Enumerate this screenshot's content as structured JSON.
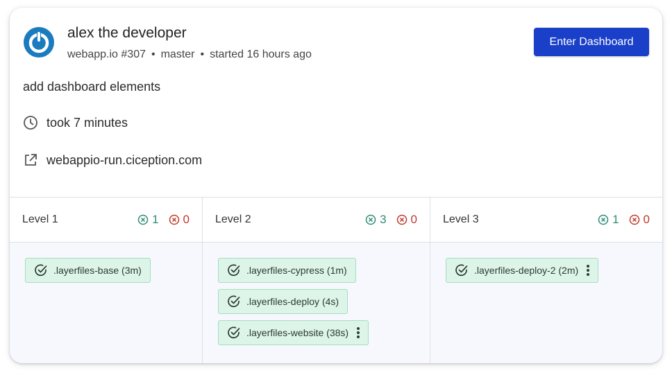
{
  "header": {
    "user_name": "alex the developer",
    "repo": "webapp.io #307",
    "branch": "master",
    "started": "started 16 hours ago",
    "enter_button": "Enter Dashboard",
    "commit_message": "add dashboard elements",
    "duration": "took 7 minutes",
    "link": "webappio-run.ciception.com"
  },
  "colors": {
    "accent": "#1a3fc9",
    "success": "#2e8b73",
    "failure": "#c0392b",
    "job_bg": "#ddf5e8",
    "avatar": "#1a7bbf"
  },
  "icons": {
    "avatar": "power-logo-icon",
    "time": "clock-icon",
    "link": "external-link-icon",
    "success": "circle-x-icon",
    "fail": "circle-x-icon",
    "job": "check-circle-icon",
    "menu": "kebab-menu-icon"
  },
  "levels": [
    {
      "title": "Level 1",
      "success_count": "1",
      "fail_count": "0",
      "jobs": [
        {
          "label": ".layerfiles-base (3m)",
          "has_menu": false
        }
      ]
    },
    {
      "title": "Level 2",
      "success_count": "3",
      "fail_count": "0",
      "jobs": [
        {
          "label": ".layerfiles-cypress (1m)",
          "has_menu": false
        },
        {
          "label": ".layerfiles-deploy (4s)",
          "has_menu": false
        },
        {
          "label": ".layerfiles-website (38s)",
          "has_menu": true
        }
      ]
    },
    {
      "title": "Level 3",
      "success_count": "1",
      "fail_count": "0",
      "jobs": [
        {
          "label": ".layerfiles-deploy-2 (2m)",
          "has_menu": true
        }
      ]
    }
  ]
}
